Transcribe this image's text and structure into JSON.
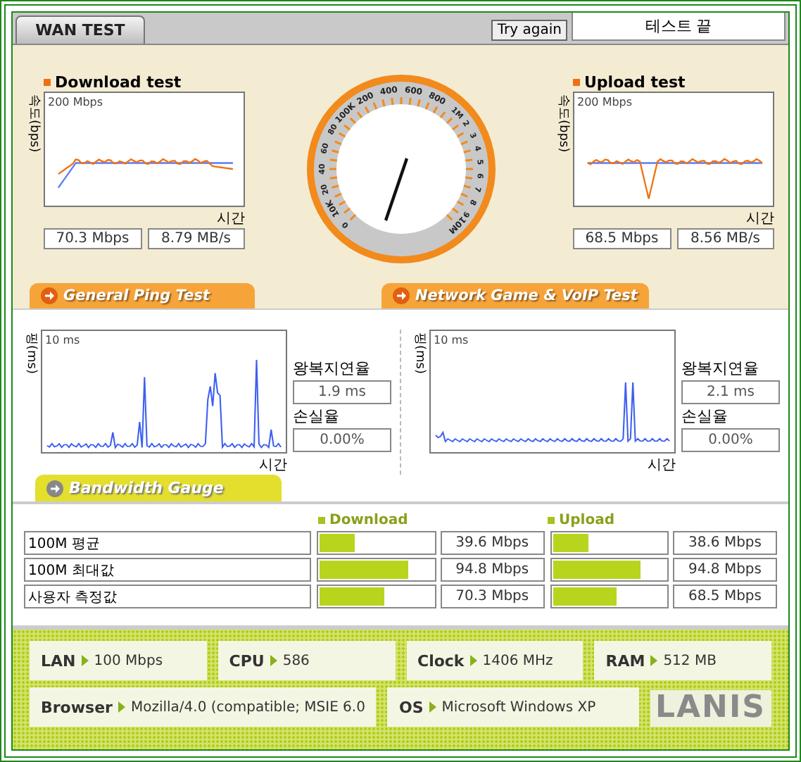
{
  "tab": {
    "label": "WAN TEST",
    "selected": true
  },
  "retry_button": "Try again",
  "status": "테스트 끝",
  "speed_tests": [
    {
      "kind": "download",
      "title": "Download test",
      "y_axis": "속도(bps)",
      "scale": "200 Mbps",
      "x_axis": "시간",
      "mbps": "70.3 Mbps",
      "mbs": "8.79 MB/s"
    },
    {
      "kind": "upload",
      "title": "Upload test",
      "y_axis": "속도(bps)",
      "scale": "200 Mbps",
      "x_axis": "시간",
      "mbps": "68.5 Mbps",
      "mbs": "8.56 MB/s"
    }
  ],
  "gauge": {
    "labels": [
      "0",
      "10K",
      "20",
      "40",
      "60",
      "80",
      "100K",
      "200",
      "400",
      "600",
      "800",
      "1M",
      "2",
      "3",
      "4",
      "5",
      "6",
      "7",
      "8",
      "9",
      "10M"
    ]
  },
  "ping_tests": [
    {
      "kind": "general",
      "title": "General Ping Test",
      "y_axis": "핑(ms)",
      "scale": "10 ms",
      "x_axis": "시간",
      "latency_label": "왕복지연율",
      "latency": "1.9 ms",
      "loss_label": "손실율",
      "loss": "0.00%"
    },
    {
      "kind": "game",
      "title": "Network Game & VoIP Test",
      "y_axis": "핑(ms)",
      "scale": "10 ms",
      "x_axis": "시간",
      "latency_label": "왕복지연율",
      "latency": "2.1 ms",
      "loss_label": "손실율",
      "loss": "0.00%"
    }
  ],
  "bandwidth": {
    "title": "Bandwidth Gauge",
    "columns": [
      "Download",
      "Upload"
    ],
    "rows": [
      {
        "label": "100M 평균",
        "download": {
          "level": 0.31,
          "reading": "39.6 Mbps"
        },
        "upload": {
          "level": 0.31,
          "reading": "38.6 Mbps"
        }
      },
      {
        "label": "100M 최대값",
        "download": {
          "level": 0.78,
          "reading": "94.8 Mbps"
        },
        "upload": {
          "level": 0.77,
          "reading": "94.8 Mbps"
        }
      },
      {
        "label": "사용자 측정값",
        "download": {
          "level": 0.57,
          "reading": "70.3 Mbps"
        },
        "upload": {
          "level": 0.57,
          "reading": "68.5 Mbps"
        }
      }
    ]
  },
  "system_info": [
    [
      {
        "label": "LAN",
        "value": "100 Mbps"
      },
      {
        "label": "CPU",
        "value": "586"
      },
      {
        "label": "Clock",
        "value": "1406 MHz"
      },
      {
        "label": "RAM",
        "value": "512 MB"
      }
    ],
    [
      {
        "label": "Browser",
        "value": "Mozilla/4.0 (compatible; MSIE 6.0"
      },
      {
        "label": "OS",
        "value": "Microsoft Windows XP"
      }
    ]
  ],
  "logo": "LANIS"
}
